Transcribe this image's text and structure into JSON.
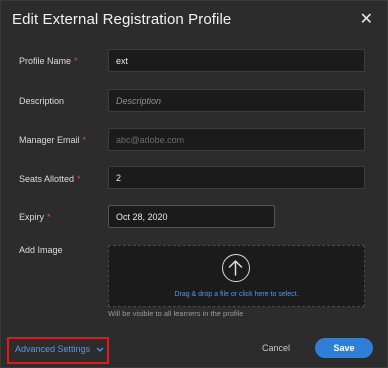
{
  "dialog": {
    "title": "Edit External Registration Profile",
    "close_icon": "close-icon"
  },
  "form": {
    "profile_name": {
      "label": "Profile Name",
      "required": "*",
      "value": "ext"
    },
    "description": {
      "label": "Description",
      "placeholder": "Description"
    },
    "manager_email": {
      "label": "Manager Email",
      "required": "*",
      "placeholder": "abc@adobe.com"
    },
    "seats_allotted": {
      "label": "Seats Allotted",
      "required": "*",
      "value": "2"
    },
    "expiry": {
      "label": "Expiry",
      "required": "*",
      "value": "Oct 28, 2020"
    },
    "add_image": {
      "label": "Add Image",
      "drop_text": "Drag & drop a file or click here to select.",
      "hint": "Will be visible to all learners in the profile",
      "icon": "upload-arrow-icon"
    }
  },
  "footer": {
    "advanced_settings": "Advanced Settings",
    "advanced_icon": "chevron-down-icon",
    "cancel": "Cancel",
    "save": "Save"
  },
  "colors": {
    "background": "#2c2c2c",
    "accent": "#2f7fd8",
    "link": "#4f9af0",
    "required": "#e24b3b",
    "highlight_box": "#e0191d"
  }
}
